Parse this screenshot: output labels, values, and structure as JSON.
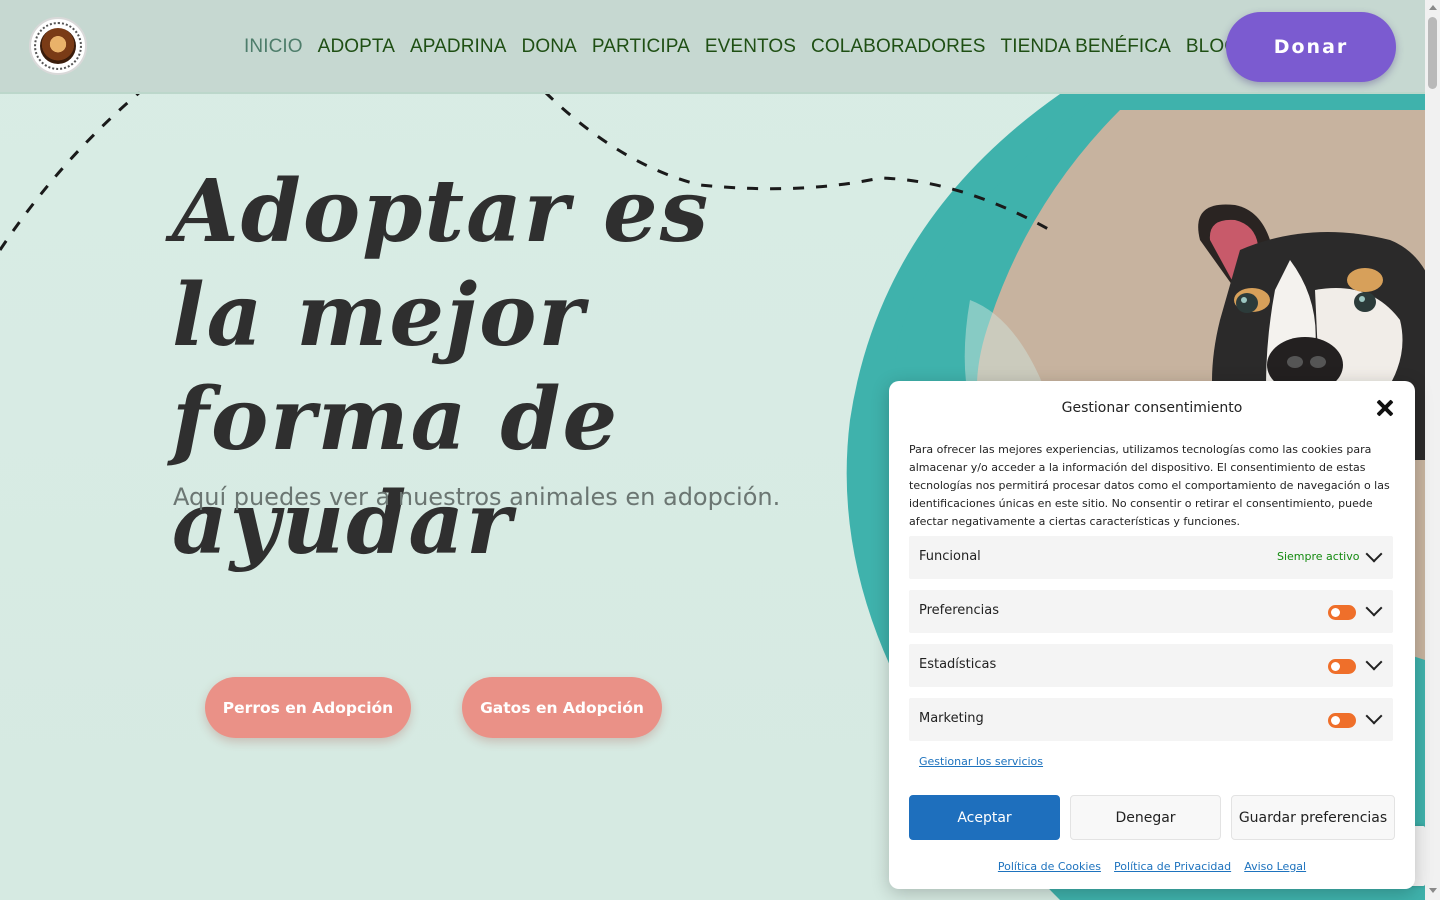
{
  "nav": {
    "items": [
      {
        "label": "INICIO",
        "active": true
      },
      {
        "label": "ADOPTA"
      },
      {
        "label": "APADRINA"
      },
      {
        "label": "DONA"
      },
      {
        "label": "PARTICIPA"
      },
      {
        "label": "EVENTOS"
      },
      {
        "label": "COLABORADORES"
      },
      {
        "label": "TIENDA BENÉFICA"
      },
      {
        "label": "BLOG"
      }
    ],
    "donate_label": "Donar"
  },
  "hero": {
    "title": "Adoptar es la mejor forma de ayudar",
    "subtitle": "Aquí puedes ver a nuestros animales en adopción.",
    "dogs_button": "Perros en Adopción",
    "cats_button": "Gatos en Adopción"
  },
  "consent": {
    "title": "Gestionar consentimiento",
    "text": "Para ofrecer las mejores experiencias, utilizamos tecnologías como las cookies para almacenar y/o acceder a la información del dispositivo. El consentimiento de estas tecnologías nos permitirá procesar datos como el comportamiento de navegación o las identificaciones únicas en este sitio. No consentir o retirar el consentimiento, puede afectar negativamente a ciertas características y funciones.",
    "categories": [
      {
        "label": "Funcional",
        "status": "Siempre activo"
      },
      {
        "label": "Preferencias"
      },
      {
        "label": "Estadísticas"
      },
      {
        "label": "Marketing"
      }
    ],
    "manage_link": "Gestionar los servicios",
    "accept": "Aceptar",
    "deny": "Denegar",
    "save": "Guardar preferencias",
    "links": [
      "Política de Cookies",
      "Política de Privacidad",
      "Aviso Legal"
    ]
  },
  "colors": {
    "accent_purple": "#7b5bd0",
    "button_salmon": "#ea9187",
    "nav_green": "#1f4f14",
    "teal": "#3fb2ac",
    "accept_blue": "#1e6fbd",
    "toggle_orange": "#ef6f2a"
  }
}
